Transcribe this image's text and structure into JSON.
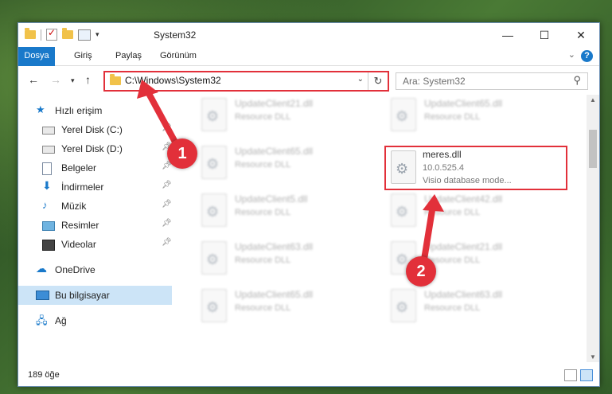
{
  "window": {
    "title": "System32",
    "controls": {
      "minimize": "—",
      "maximize": "☐",
      "close": "✕"
    }
  },
  "ribbon": {
    "tabs": [
      "Dosya",
      "Giriş",
      "Paylaş",
      "Görünüm"
    ],
    "help": "?"
  },
  "address": {
    "path": "C:\\Windows\\System32"
  },
  "search": {
    "placeholder": "Ara: System32"
  },
  "sidebar": {
    "items": [
      {
        "label": "Hızlı erişim",
        "icon": "star-icon"
      },
      {
        "label": "Yerel Disk (C:)",
        "icon": "drive-icon"
      },
      {
        "label": "Yerel Disk (D:)",
        "icon": "drive-icon"
      },
      {
        "label": "Belgeler",
        "icon": "documents-icon"
      },
      {
        "label": "İndirmeler",
        "icon": "download-icon"
      },
      {
        "label": "Müzik",
        "icon": "music-icon"
      },
      {
        "label": "Resimler",
        "icon": "pictures-icon"
      },
      {
        "label": "Videolar",
        "icon": "videos-icon"
      },
      {
        "label": "OneDrive",
        "icon": "cloud-icon"
      },
      {
        "label": "Bu bilgisayar",
        "icon": "computer-icon"
      },
      {
        "label": "Ağ",
        "icon": "network-icon"
      }
    ]
  },
  "files": {
    "blurred": [
      {
        "name": "UpdateClient21.dll",
        "type": "Resource DLL"
      },
      {
        "name": "UpdateClient65.dll",
        "type": "Resource DLL"
      },
      {
        "name": "UpdateClient65.dll",
        "type": "Resource DLL"
      },
      {
        "name": "UpdateClient5.dll",
        "type": "Resource DLL"
      },
      {
        "name": "UpdateClient42.dll",
        "type": "Resource DLL"
      },
      {
        "name": "UpdateClient63.dll",
        "type": "Resource DLL"
      },
      {
        "name": "UpdateClient21.dll",
        "type": "Resource DLL"
      },
      {
        "name": "UpdateClient65.dll",
        "type": "Resource DLL"
      },
      {
        "name": "UpdateClient63.dll",
        "type": "Resource DLL"
      }
    ],
    "highlighted": {
      "name": "meres.dll",
      "version": "10.0.525.4",
      "description": "Visio database mode..."
    }
  },
  "status": {
    "count": "189 öğe"
  },
  "callouts": [
    "1",
    "2"
  ],
  "colors": {
    "accent": "#1979ca",
    "highlight": "#e2303a"
  }
}
